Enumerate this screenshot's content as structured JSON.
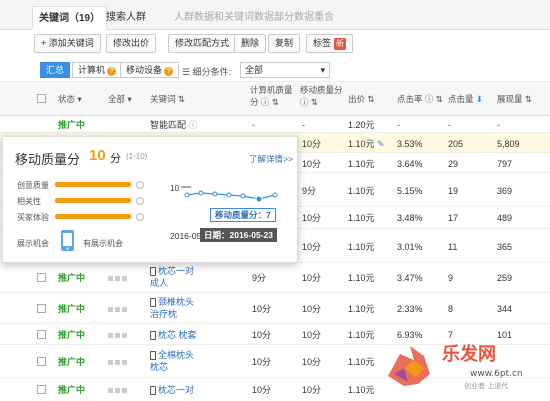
{
  "tabs": [
    {
      "label": "关键词（19）"
    },
    {
      "label": "搜索人群"
    },
    {
      "label": "人群数据和关键词数据部分数据重合"
    }
  ],
  "toolbar": {
    "add_keyword": "+ 添加关键词",
    "edit_bid": "修改出价",
    "edit_match": "修改匹配方式",
    "delete": "删除",
    "copy": "复制",
    "tag": "标签",
    "tag_badge": "新"
  },
  "subbar": {
    "summary": "汇总",
    "computer": "计算机",
    "mobile": "移动设备",
    "filter_label": "细分条件:",
    "filter_value": "全部"
  },
  "columns": {
    "status": "状态",
    "all": "全部",
    "keyword": "关键词",
    "pc_quality_1": "计算机质量",
    "pc_quality_2": "分",
    "mobile_quality_1": "移动质量分",
    "bid": "出价",
    "ctr": "点击率",
    "clicks": "点击量",
    "impressions": "展现量"
  },
  "rows": [
    {
      "status": "推广中",
      "keyword": "智能匹配",
      "pc": "-",
      "mobile": "-",
      "bid": "1.20元",
      "ctr": "-",
      "clicks": "-",
      "impr": "-"
    },
    {
      "status": "",
      "keyword": "",
      "pc": "",
      "mobile": "10分",
      "bid": "1.10元",
      "ctr": "3.53%",
      "clicks": "205",
      "impr": "5,809"
    },
    {
      "status": "",
      "keyword": "",
      "pc": "",
      "mobile": "10分",
      "bid": "1.10元",
      "ctr": "3.64%",
      "clicks": "29",
      "impr": "797"
    },
    {
      "status": "",
      "keyword": "",
      "pc": "",
      "mobile": "9分",
      "bid": "1.10元",
      "ctr": "5.15%",
      "clicks": "19",
      "impr": "369"
    },
    {
      "status": "",
      "keyword": "",
      "pc": "",
      "mobile": "10分",
      "bid": "1.10元",
      "ctr": "3.48%",
      "clicks": "17",
      "impr": "489"
    },
    {
      "status": "",
      "keyword": "",
      "pc": "",
      "mobile": "10分",
      "bid": "1.10元",
      "ctr": "3.01%",
      "clicks": "11",
      "impr": "365"
    },
    {
      "status": "推广中",
      "keyword_1": "枕芯一对",
      "keyword_2": "成人",
      "pc": "9分",
      "mobile": "10分",
      "bid": "1.10元",
      "ctr": "3.47%",
      "clicks": "9",
      "impr": "259"
    },
    {
      "status": "推广中",
      "keyword_1": "颈椎枕头",
      "keyword_2": "治疗枕",
      "pc": "10分",
      "mobile": "10分",
      "bid": "1.10元",
      "ctr": "2.33%",
      "clicks": "8",
      "impr": "344"
    },
    {
      "status": "推广中",
      "keyword": "枕芯 枕套",
      "pc": "10分",
      "mobile": "10分",
      "bid": "1.10元",
      "ctr": "6.93%",
      "clicks": "7",
      "impr": "101"
    },
    {
      "status": "推广中",
      "keyword_1": "全棉枕头",
      "keyword_2": "枕芯",
      "pc": "10分",
      "mobile": "10分",
      "bid": "1.10元",
      "ctr": "",
      "clicks": "",
      "impr": ""
    },
    {
      "status": "推广中",
      "keyword": "枕芯一对",
      "pc": "10分",
      "mobile": "10分",
      "bid": "1.10元",
      "ctr": "",
      "clicks": "",
      "impr": ""
    }
  ],
  "popup": {
    "title": "移动质量分",
    "score": "10",
    "unit": "分",
    "range": "(1-10)",
    "link": "了解详情>>",
    "metrics": [
      {
        "label": "创意质量",
        "level": 1.0
      },
      {
        "label": "相关性",
        "level": 1.0
      },
      {
        "label": "买家体验",
        "level": 1.0
      }
    ],
    "device_label": "展示机会",
    "device_value": "有展示机会",
    "chart_y_label": "10",
    "chart_x_label": "2016-05-",
    "tip_score": "移动质量分：7",
    "tip_date": "日期：2016-05-23"
  },
  "watermark": {
    "brand": "乐发网",
    "site": "www.6pt.cn",
    "slogan": "创业者·上道代"
  },
  "colors": {
    "accent": "#3a8ee6",
    "orange": "#f39c12",
    "green": "#2e9e2e"
  }
}
